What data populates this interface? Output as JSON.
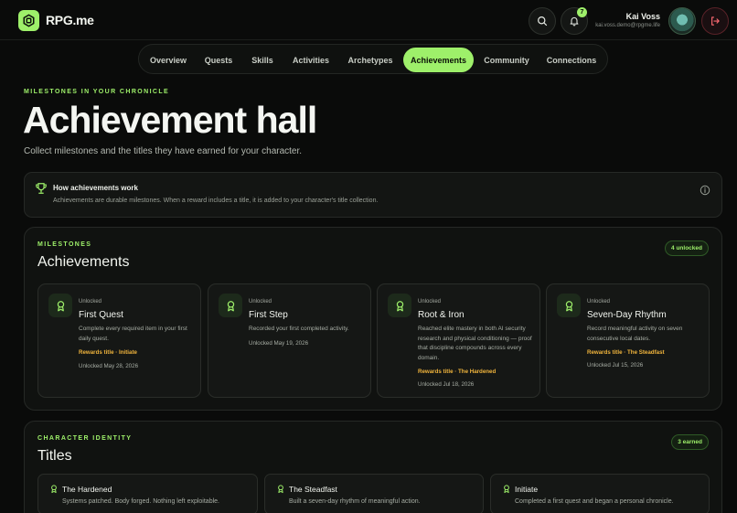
{
  "app": {
    "name": "RPG.me"
  },
  "user": {
    "name": "Kai Voss",
    "email": "kai.voss.demo@rpgme.life",
    "notifications": "7"
  },
  "nav": {
    "items": [
      {
        "label": "Overview"
      },
      {
        "label": "Quests"
      },
      {
        "label": "Skills"
      },
      {
        "label": "Activities"
      },
      {
        "label": "Archetypes"
      },
      {
        "label": "Achievements",
        "active": true
      },
      {
        "label": "Community"
      },
      {
        "label": "Connections"
      }
    ]
  },
  "hero": {
    "eyebrow": "MILESTONES IN YOUR CHRONICLE",
    "title": "Achievement hall",
    "subtitle": "Collect milestones and the titles they have earned for your character."
  },
  "info": {
    "title": "How achievements work",
    "text": "Achievements are durable milestones. When a reward includes a title, it is added to your character's title collection."
  },
  "milestones": {
    "eyebrow": "MILESTONES",
    "title": "Achievements",
    "badge": "4 unlocked",
    "cards": [
      {
        "status": "Unlocked",
        "title": "First Quest",
        "desc": "Complete every required item in your first daily quest.",
        "reward": "Rewards title · Initiate",
        "date": "Unlocked May 28, 2026"
      },
      {
        "status": "Unlocked",
        "title": "First Step",
        "desc": "Recorded your first completed activity.",
        "reward": "",
        "date": "Unlocked May 19, 2026"
      },
      {
        "status": "Unlocked",
        "title": "Root & Iron",
        "desc": "Reached elite mastery in both AI security research and physical conditioning — proof that discipline compounds across every domain.",
        "reward": "Rewards title · The Hardened",
        "date": "Unlocked Jul 18, 2026"
      },
      {
        "status": "Unlocked",
        "title": "Seven-Day Rhythm",
        "desc": "Record meaningful activity on seven consecutive local dates.",
        "reward": "Rewards title · The Steadfast",
        "date": "Unlocked Jul 15, 2026"
      }
    ]
  },
  "titles": {
    "eyebrow": "CHARACTER IDENTITY",
    "title": "Titles",
    "badge": "3 earned",
    "cards": [
      {
        "name": "The Hardened",
        "desc": "Systems patched. Body forged. Nothing left exploitable."
      },
      {
        "name": "The Steadfast",
        "desc": "Built a seven-day rhythm of meaningful action."
      },
      {
        "name": "Initiate",
        "desc": "Completed a first quest and began a personal chronicle."
      }
    ]
  },
  "colors": {
    "accent": "#9ef06a",
    "reward": "#f0b43c",
    "background": "#0a0b0a"
  }
}
